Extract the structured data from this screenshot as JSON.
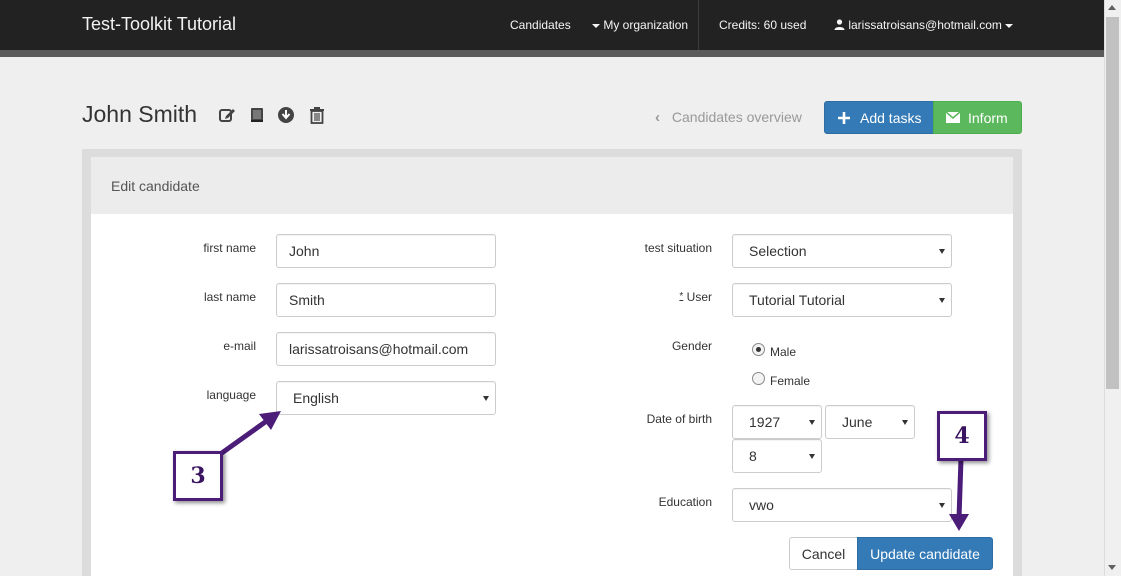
{
  "navbar": {
    "brand": "Test-Toolkit Tutorial",
    "candidates": "Candidates",
    "organization": "My organization",
    "credits": "Credits: 60 used",
    "user_email": "larissatroisans@hotmail.com"
  },
  "header": {
    "title": "John Smith",
    "icons": [
      "edit-icon",
      "book-icon",
      "download-icon",
      "trash-icon"
    ],
    "back_link": "Candidates overview",
    "add_tasks": "Add tasks",
    "inform": "Inform"
  },
  "panel": {
    "title": "Edit candidate"
  },
  "form": {
    "first_name": {
      "label": "first name",
      "value": "John"
    },
    "last_name": {
      "label": "last name",
      "value": "Smith"
    },
    "email": {
      "label": "e-mail",
      "value": "larissatroisans@hotmail.com"
    },
    "language": {
      "label": "language",
      "value": "English"
    },
    "test_situation": {
      "label": "test situation",
      "value": "Selection"
    },
    "user": {
      "required_mark": "*",
      "label": "User",
      "value": "Tutorial Tutorial"
    },
    "gender": {
      "label": "Gender",
      "options": [
        "Male",
        "Female"
      ],
      "selected": "Male"
    },
    "dob": {
      "label": "Date of birth",
      "year": "1927",
      "month": "June",
      "day": "8"
    },
    "education": {
      "label": "Education",
      "value": "vwo"
    }
  },
  "actions": {
    "cancel": "Cancel",
    "update": "Update candidate"
  },
  "annotations": {
    "callout_3": "3",
    "callout_4": "4"
  },
  "colors": {
    "navbar_bg": "#222222",
    "primary": "#337ab7",
    "success": "#5cb85c",
    "callout_border": "#4b1c78"
  }
}
